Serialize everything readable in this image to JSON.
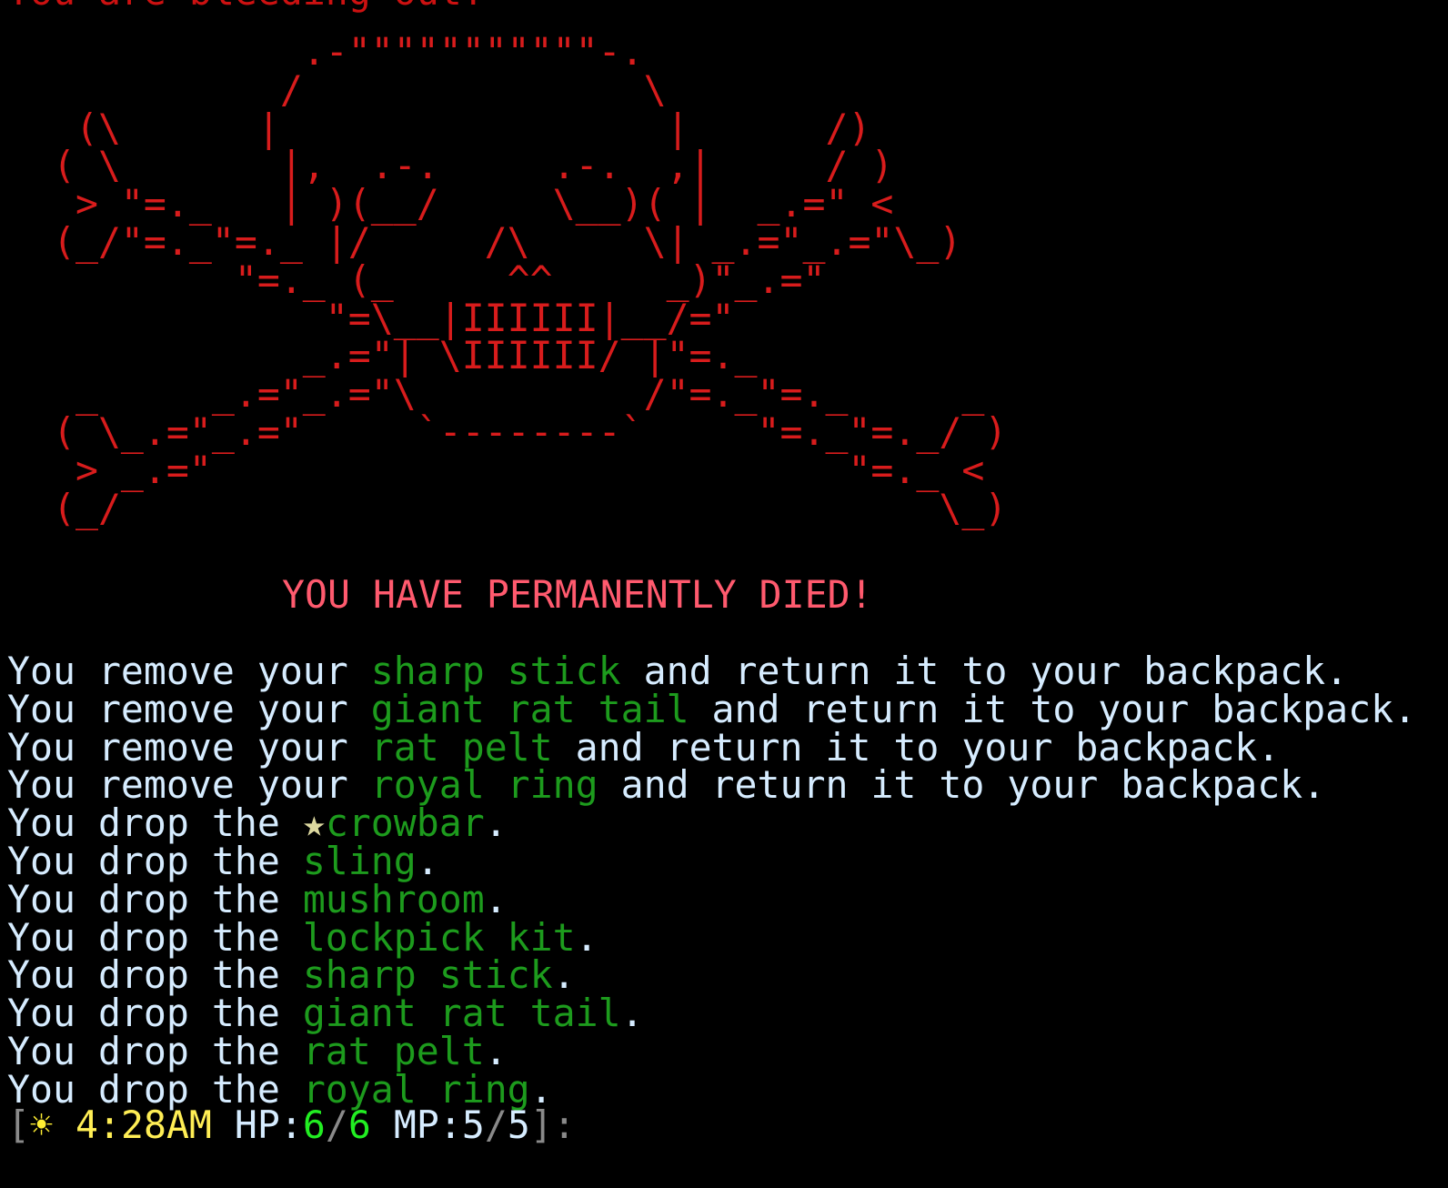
{
  "top_message": "You are bleeding out!",
  "skull_art": [
    "             .-\"\"\"\"\"\"\"\"\"\"\"-.",
    "            /               \\",
    "   (\\      |                 |      /)",
    "  ( \\       |,  .-.     .-.  ,|     / )",
    "   > \"=._   | )(__/     \\__)( |  _.=\" <",
    "  (_/\"=._\"=._ |/     /\\     \\| _.=\"_.=\"\\_)",
    "          \"=._ (_     ^^     _)\"_.=\"",
    "              \"=\\__|IIIIII|__/=\"",
    "             _.=\"| \\IIIIII/ |\"=._",
    "   _     _.=\"_.=\"\\          /\"=._\"=._     _",
    "  ( \\_.=\"_.=\"     `--------`     \"=._\"=._/ )",
    "   > _.=\"                            \"=._ <",
    "  (_/                                    \\_)"
  ],
  "death_banner": "YOU HAVE PERMANENTLY DIED!",
  "messages": [
    {
      "pre": "You remove your ",
      "item": "sharp stick",
      "post": " and return it to your backpack."
    },
    {
      "pre": "You remove your ",
      "item": "giant rat tail",
      "post": " and return it to your backpack."
    },
    {
      "pre": "You remove your ",
      "item": "rat pelt",
      "post": " and return it to your backpack."
    },
    {
      "pre": "You remove your ",
      "item": "royal ring",
      "post": " and return it to your backpack."
    },
    {
      "pre": "You drop the ",
      "star": "★",
      "item": "crowbar",
      "post": "."
    },
    {
      "pre": "You drop the ",
      "item": "sling",
      "post": "."
    },
    {
      "pre": "You drop the ",
      "item": "mushroom",
      "post": "."
    },
    {
      "pre": "You drop the ",
      "item": "lockpick kit",
      "post": "."
    },
    {
      "pre": "You drop the ",
      "item": "sharp stick",
      "post": "."
    },
    {
      "pre": "You drop the ",
      "item": "giant rat tail",
      "post": "."
    },
    {
      "pre": "You drop the ",
      "item": "rat pelt",
      "post": "."
    },
    {
      "pre": "You drop the ",
      "item": "royal ring",
      "post": "."
    }
  ],
  "status": {
    "open_bracket": "[",
    "sun_icon": "☀",
    "time": "4:28AM",
    "hp_label": "HP:",
    "hp_current": "6",
    "hp_max": "6",
    "mp_label": "MP:",
    "mp_current": "5",
    "mp_max": "5",
    "close_bracket": "]",
    "prompt": ":"
  },
  "colors": {
    "background": "#000000",
    "text": "#d6ecff",
    "item": "#1d9b1d",
    "skull": "#d81c1c",
    "banner": "#ff5a6e",
    "hp": "#22ee22",
    "time": "#ffee55"
  }
}
